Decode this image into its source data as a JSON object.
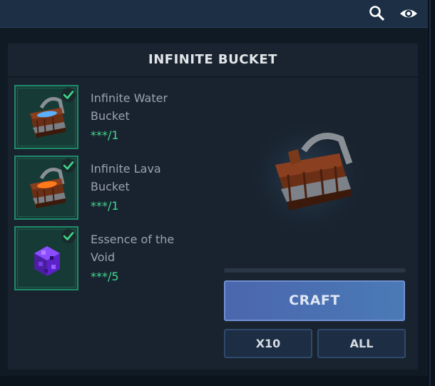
{
  "header": {
    "icons": [
      "search-icon",
      "eye-icon"
    ]
  },
  "panel": {
    "title": "INFINITE BUCKET"
  },
  "ingredients": [
    {
      "name": "Infinite Water Bucket",
      "qty": "***/1",
      "icon": "water-bucket-icon",
      "checked": true
    },
    {
      "name": "Infinite Lava Bucket",
      "qty": "***/1",
      "icon": "lava-bucket-icon",
      "checked": true
    },
    {
      "name": "Essence of the Void",
      "qty": "***/5",
      "icon": "void-essence-icon",
      "checked": true
    }
  ],
  "preview": {
    "icon": "infinite-bucket-icon"
  },
  "actions": {
    "craft_label": "CRAFT",
    "x10_label": "X10",
    "all_label": "ALL"
  },
  "colors": {
    "accent": "#4b6fb2",
    "ingredient_ok": "#3ed88e",
    "slot_border": "#1e8a6a"
  }
}
